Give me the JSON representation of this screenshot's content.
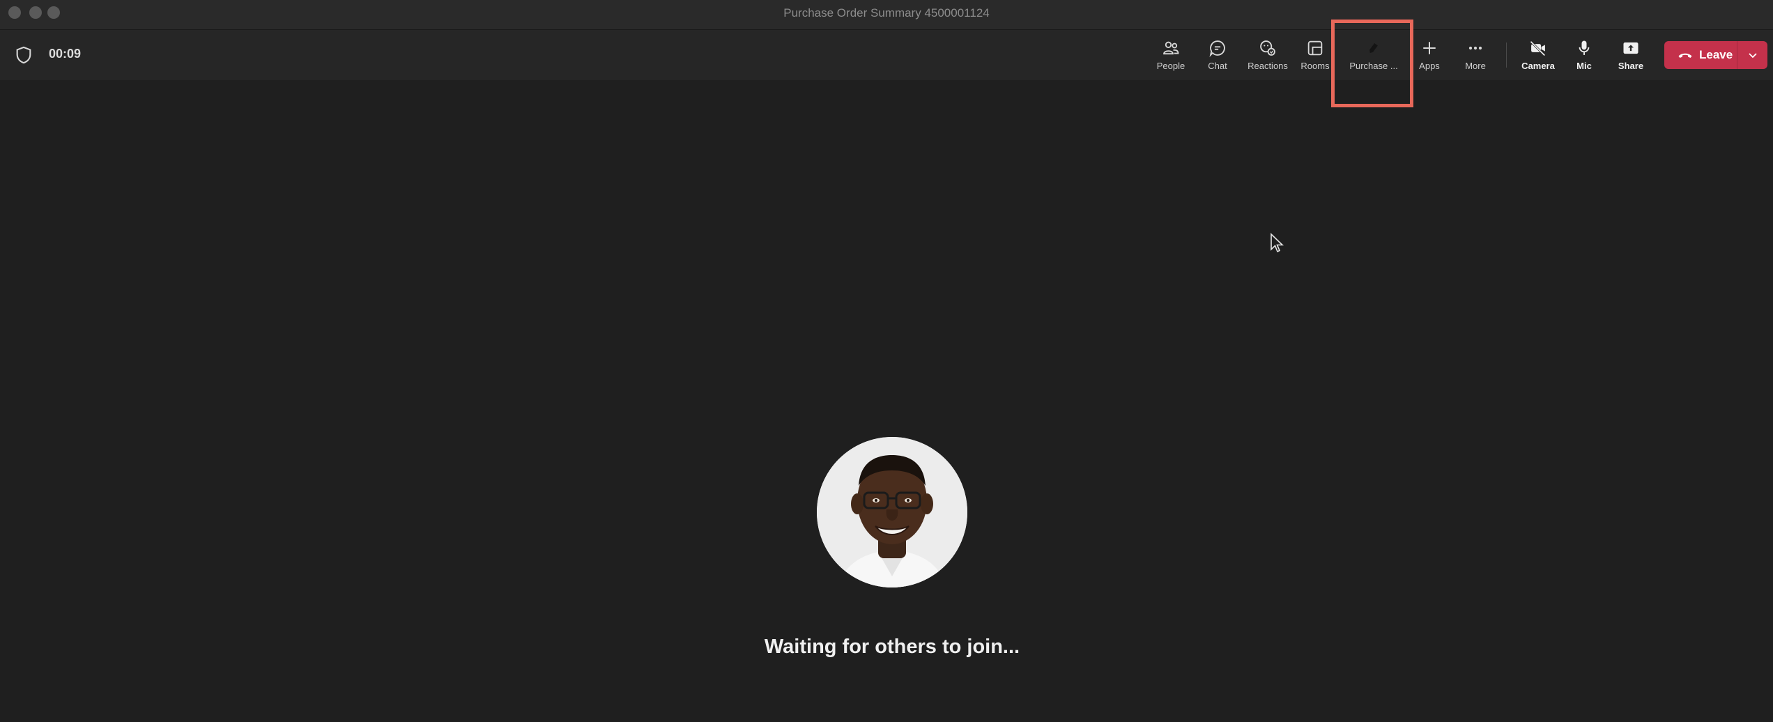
{
  "window": {
    "title": "Purchase Order Summary 4500001124"
  },
  "toolbar": {
    "timer": "00:09",
    "buttons": {
      "people": "People",
      "chat": "Chat",
      "reactions": "Reactions",
      "rooms": "Rooms",
      "purchase": "Purchase ...",
      "apps": "Apps",
      "more": "More",
      "camera": "Camera",
      "mic": "Mic",
      "share": "Share"
    },
    "leave_label": "Leave"
  },
  "stage": {
    "waiting_text": "Waiting for others to join..."
  },
  "colors": {
    "background": "#1f1f1f",
    "toolbar": "#262626",
    "leave_button": "#c4314b",
    "highlight_box": "#e8685a"
  }
}
